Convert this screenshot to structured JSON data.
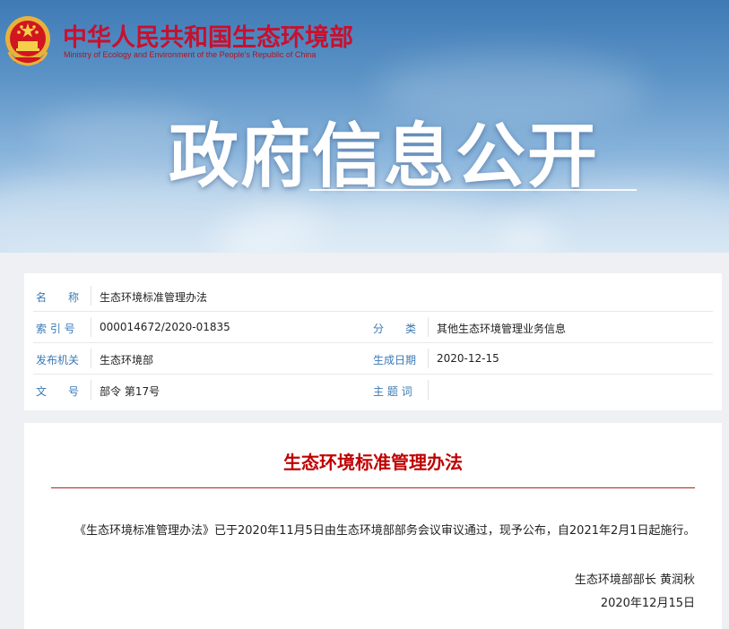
{
  "header": {
    "ministry_cn": "中华人民共和国生态环境部",
    "ministry_en": "Ministry of Ecology and Environment of the People's Republic of China",
    "banner_title": "政府信息公开"
  },
  "meta": {
    "name_label": "名　　称",
    "name_value": "生态环境标准管理办法",
    "index_label": "索 引 号",
    "index_value": "000014672/2020-01835",
    "category_label": "分　　类",
    "category_value": "其他生态环境管理业务信息",
    "issuer_label": "发布机关",
    "issuer_value": "生态环境部",
    "date_label": "生成日期",
    "date_value": "2020-12-15",
    "docno_label": "文　　号",
    "docno_value": "部令 第17号",
    "keywords_label": "主 题 词",
    "keywords_value": ""
  },
  "document": {
    "title": "生态环境标准管理办法",
    "paragraph": "《生态环境标准管理办法》已于2020年11月5日由生态环境部部务会议审议通过，现予公布，自2021年2月1日起施行。",
    "signature": "生态环境部部长 黄润秋",
    "date": "2020年12月15日"
  },
  "colors": {
    "accent_red": "#c00000",
    "label_blue": "#3a79b5"
  }
}
